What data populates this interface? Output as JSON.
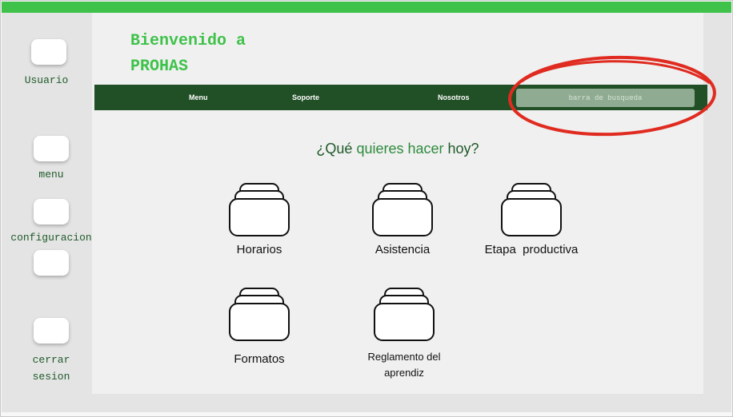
{
  "header": {
    "title": "Bienvenido a\nPROHAS"
  },
  "sidebar": {
    "items": [
      {
        "label": "Usuario"
      },
      {
        "label": "menu"
      },
      {
        "label": "configuracion"
      },
      {
        "label": ""
      },
      {
        "label": "cerrar\nsesion"
      }
    ]
  },
  "nav": {
    "items": [
      "Menu",
      "Soporte",
      "Nosotros"
    ],
    "search_placeholder": "barra de busqueda"
  },
  "question": {
    "part1": "¿Qué ",
    "accent": "quieres hacer",
    "part2": " hoy?"
  },
  "cards": [
    {
      "label": "Horarios",
      "icon": "folder-stack-icon"
    },
    {
      "label": "Asistencia",
      "icon": "folder-stack-icon"
    },
    {
      "label": "Etapa  productiva",
      "icon": "folder-stack-icon"
    },
    {
      "label": "Formatos",
      "icon": "folder-stack-icon"
    },
    {
      "label": "Reglamento del\naprendiz",
      "icon": "folder-stack-icon"
    }
  ],
  "colors": {
    "accent_green": "#3ec24a",
    "nav_dark_green": "#214f26",
    "annotation_red": "#e02b20"
  }
}
